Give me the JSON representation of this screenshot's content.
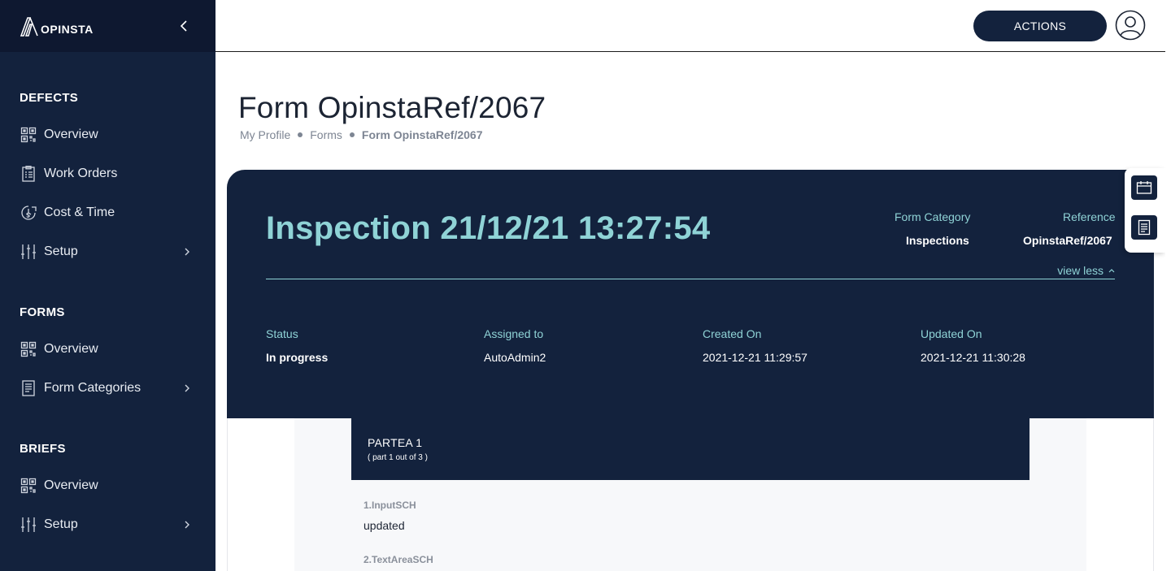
{
  "sidebar": {
    "logo_text": "OPINSTA",
    "sections": [
      {
        "title": "DEFECTS",
        "items": [
          {
            "label": "Overview",
            "icon": "qr-grid-icon"
          },
          {
            "label": "Work Orders",
            "icon": "clipboard-icon"
          },
          {
            "label": "Cost & Time",
            "icon": "clock-dollar-icon"
          },
          {
            "label": "Setup",
            "icon": "sliders-icon",
            "has_submenu": true
          }
        ]
      },
      {
        "title": "FORMS",
        "items": [
          {
            "label": "Overview",
            "icon": "qr-grid-icon"
          },
          {
            "label": "Form Categories",
            "icon": "document-icon",
            "has_submenu": true
          }
        ]
      },
      {
        "title": "BRIEFS",
        "items": [
          {
            "label": "Overview",
            "icon": "qr-grid-icon"
          },
          {
            "label": "Setup",
            "icon": "sliders-icon",
            "has_submenu": true
          }
        ]
      }
    ]
  },
  "topbar": {
    "actions_label": "ACTIONS"
  },
  "page": {
    "title": "Form OpinstaRef/2067",
    "breadcrumb": [
      "My Profile",
      "Forms",
      "Form OpinstaRef/2067"
    ]
  },
  "card": {
    "title": "Inspection 21/12/21 13:27:54",
    "form_category_label": "Form Category",
    "form_category_value": "Inspections",
    "reference_label": "Reference",
    "reference_value": "OpinstaRef/2067",
    "view_less_label": "view less",
    "details": [
      {
        "label": "Status",
        "value": "In progress"
      },
      {
        "label": "Assigned to",
        "value": "AutoAdmin2"
      },
      {
        "label": "Created On",
        "value": "2021-12-21 11:29:57"
      },
      {
        "label": "Updated On",
        "value": "2021-12-21 11:30:28"
      }
    ]
  },
  "form": {
    "part_title": "PARTEA 1",
    "part_subtitle": "( part 1 out of 3 )",
    "fields": [
      {
        "label": "1.InputSCH",
        "value": "updated"
      },
      {
        "label": "2.TextAreaSCH",
        "value": ""
      }
    ]
  },
  "colors": {
    "navy": "#13223d",
    "accent": "#8fd3d6"
  }
}
